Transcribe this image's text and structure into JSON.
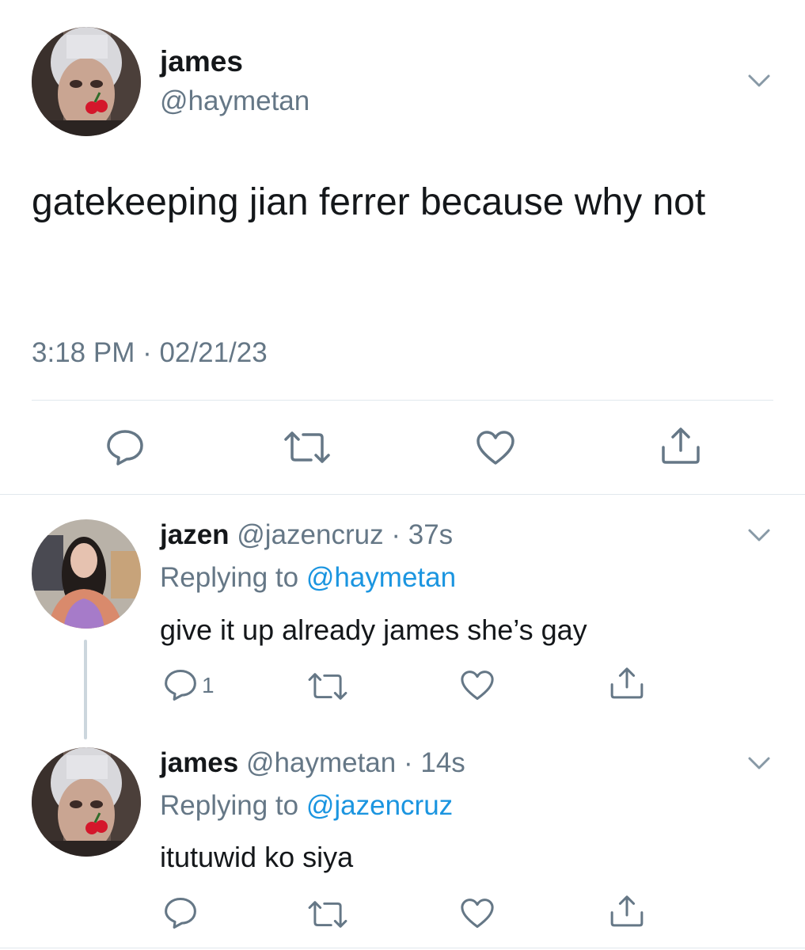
{
  "tweet": {
    "author_name": "james",
    "author_handle": "@haymetan",
    "text": "gatekeeping jian ferrer because why not",
    "timestamp": "3:18 PM · 02/21/23"
  },
  "replies": [
    {
      "name": "jazen",
      "handle": "@jazencruz",
      "time": "37s",
      "replying_label": "Replying to",
      "replying_to": "@haymetan",
      "text": "give it up already james she’s gay",
      "reply_count": "1"
    },
    {
      "name": "james",
      "handle": "@haymetan",
      "time": "14s",
      "replying_label": "Replying to",
      "replying_to": "@jazencruz",
      "text": "itutuwid ko siya",
      "reply_count": ""
    }
  ],
  "separator": "·",
  "icons": {
    "reply": "reply-icon",
    "retweet": "retweet-icon",
    "like": "heart-icon",
    "share": "share-icon",
    "more": "chevron-down-icon"
  },
  "colors": {
    "text": "#14171a",
    "secondary": "#657786",
    "link": "#1b95e0",
    "divider": "#e1e8ed"
  }
}
